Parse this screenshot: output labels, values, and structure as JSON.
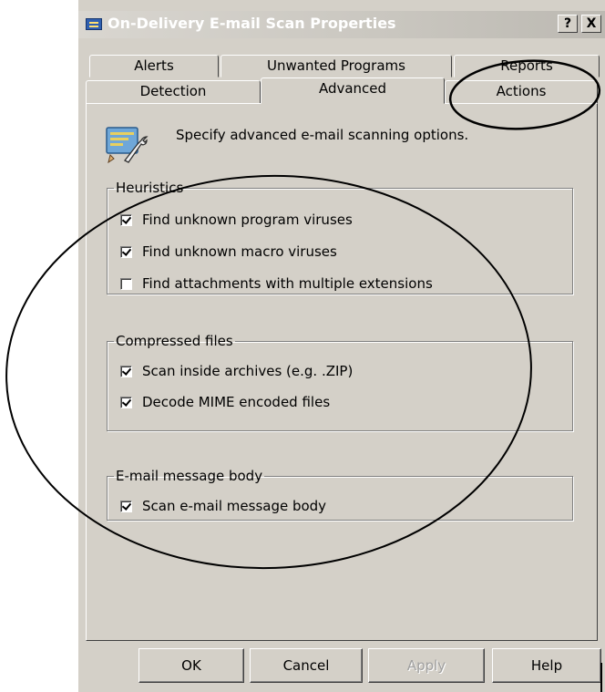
{
  "window": {
    "title": "On-Delivery E-mail Scan Properties",
    "help_button": "?",
    "close_button": "X"
  },
  "tabs_back": [
    {
      "label": "Alerts"
    },
    {
      "label": "Unwanted Programs"
    },
    {
      "label": "Reports"
    }
  ],
  "tabs_front": [
    {
      "label": "Detection"
    },
    {
      "label": "Advanced",
      "active": true
    },
    {
      "label": "Actions"
    }
  ],
  "panel": {
    "description": "Specify advanced e-mail scanning options.",
    "icon": "settings-wrench-icon",
    "groups": [
      {
        "title": "Heuristics",
        "options": [
          {
            "label": "Find unknown program viruses",
            "checked": true
          },
          {
            "label": "Find unknown macro viruses",
            "checked": true
          },
          {
            "label": "Find attachments with multiple extensions",
            "checked": false
          }
        ]
      },
      {
        "title": "Compressed files",
        "options": [
          {
            "label": "Scan inside archives (e.g. .ZIP)",
            "checked": true
          },
          {
            "label": "Decode MIME encoded files",
            "checked": true
          }
        ]
      },
      {
        "title": "E-mail message body",
        "options": [
          {
            "label": "Scan e-mail message body",
            "checked": true
          }
        ]
      }
    ]
  },
  "buttons": {
    "ok": "OK",
    "cancel": "Cancel",
    "apply": "Apply",
    "help": "Help"
  }
}
